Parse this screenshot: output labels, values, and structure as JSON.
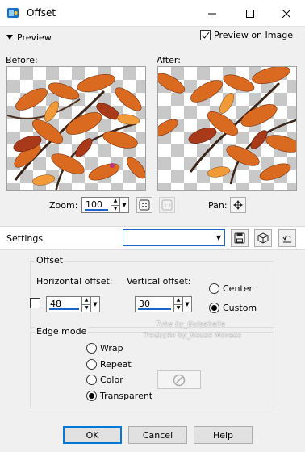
{
  "window": {
    "title": "Offset"
  },
  "preview": {
    "section_label": "Preview",
    "preview_on_image_label": "Preview on Image",
    "preview_on_image_checked": true
  },
  "before": {
    "label": "Before:"
  },
  "after": {
    "label": "After:"
  },
  "zoom": {
    "label": "Zoom:",
    "value": "100"
  },
  "pan": {
    "label": "Pan:"
  },
  "settings": {
    "label": "Settings",
    "preset_value": ""
  },
  "offset": {
    "group_label": "Offset",
    "horizontal_label": "Horizontal offset:",
    "horizontal_value": "48",
    "vertical_label": "Vertical offset:",
    "vertical_value": "30",
    "center_label": "Center",
    "custom_label": "Custom",
    "selected": "Custom"
  },
  "edge_mode": {
    "group_label": "Edge mode",
    "options": [
      "Wrap",
      "Repeat",
      "Color",
      "Transparent"
    ],
    "selected": "Transparent"
  },
  "watermark": {
    "line1": "Tube by_Guisaballa",
    "line2": "Tradução by_Neusa Novaes"
  },
  "buttons": {
    "ok": "OK",
    "cancel": "Cancel",
    "help": "Help"
  },
  "colors": {
    "accent": "#1e63c8",
    "leaf_orange": "#d2691e",
    "leaf_red": "#a52a1e"
  },
  "icons": [
    "app-icon",
    "minimize-icon",
    "maximize-icon",
    "close-icon",
    "zoom-fit-icon",
    "zoom-actual-icon",
    "pan-move-icon",
    "save-preset-icon",
    "preset-3d-icon",
    "reset-icon",
    "no-color-icon"
  ]
}
